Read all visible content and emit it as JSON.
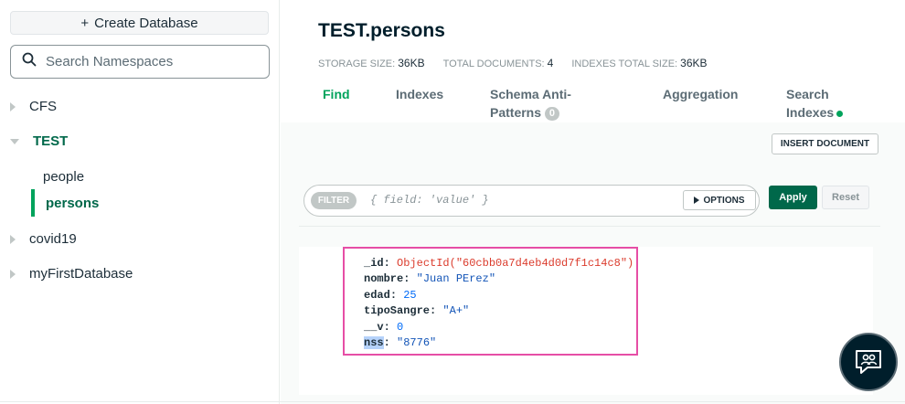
{
  "sidebar": {
    "create_database_label": "Create Database",
    "search_placeholder": "Search Namespaces",
    "databases": [
      {
        "name": "CFS",
        "expanded": false
      },
      {
        "name": "TEST",
        "expanded": true,
        "collections": [
          "people",
          "persons"
        ]
      },
      {
        "name": "covid19",
        "expanded": false
      },
      {
        "name": "myFirstDatabase",
        "expanded": false
      }
    ]
  },
  "collection": {
    "title": "TEST.persons",
    "storage_size_label": "STORAGE SIZE:",
    "storage_size_value": "36KB",
    "total_documents_label": "TOTAL DOCUMENTS:",
    "total_documents_value": "4",
    "indexes_size_label": "INDEXES TOTAL SIZE:",
    "indexes_size_value": "36KB"
  },
  "tabs": {
    "find": "Find",
    "indexes": "Indexes",
    "schema_line1": "Schema Anti-",
    "schema_line2": "Patterns",
    "schema_badge": "0",
    "aggregation": "Aggregation",
    "search_line1": "Search",
    "search_line2": "Indexes",
    "active": "Find"
  },
  "toolbar": {
    "insert_document": "INSERT DOCUMENT",
    "filter_pill": "FILTER",
    "filter_placeholder": "{ field: 'value' }",
    "options": "OPTIONS",
    "apply": "Apply",
    "reset": "Reset"
  },
  "document": {
    "fields": [
      {
        "key": "_id",
        "value": "ObjectId(\"60cbb0a7d4eb4d0d7f1c14c8\")",
        "type": "oid"
      },
      {
        "key": "nombre",
        "value": "\"Juan PErez\"",
        "type": "str"
      },
      {
        "key": "edad",
        "value": "25",
        "type": "num"
      },
      {
        "key": "tipoSangre",
        "value": "\"A+\"",
        "type": "str"
      },
      {
        "key": "__v",
        "value": "0",
        "type": "num"
      },
      {
        "key": "nss",
        "value": "\"8776\"",
        "type": "str"
      }
    ]
  },
  "colors": {
    "accent_green": "#00a35c",
    "apply_green": "#00684a",
    "highlight_pink": "#e64ea6",
    "objectid_red": "#db3c2d",
    "string_blue": "#1254b7"
  },
  "icons": {
    "search": "search-icon",
    "plus": "plus-icon",
    "options_caret": "caret-right-icon",
    "chat": "chat-people-icon"
  }
}
